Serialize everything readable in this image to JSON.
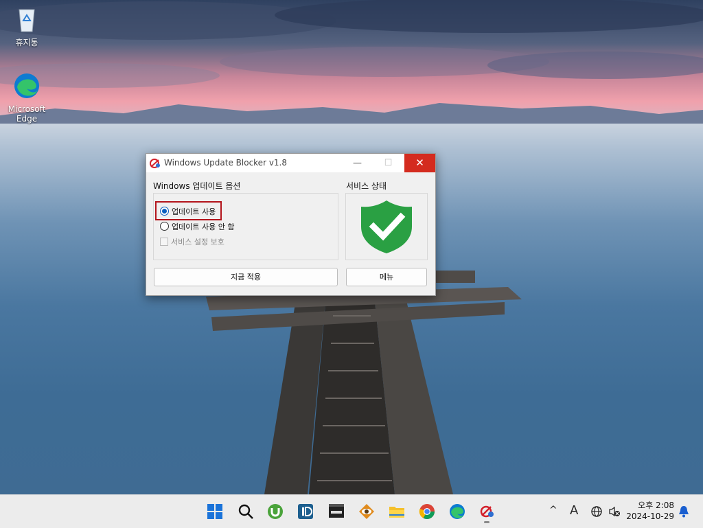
{
  "desktop": {
    "icons": [
      {
        "label": "휴지통"
      },
      {
        "label_line1": "Microsoft",
        "label_line2": "Edge"
      }
    ]
  },
  "window": {
    "title": "Windows Update Blocker v1.8",
    "minimize_glyph": "—",
    "maximize_glyph": "☐",
    "close_glyph": "✕",
    "options_group_label": "Windows 업데이트 옵션",
    "status_group_label": "서비스 상태",
    "options": [
      {
        "label": "업데이트 사용",
        "selected": true
      },
      {
        "label": "업데이트 사용 안 함",
        "selected": false
      }
    ],
    "protect_checkbox": {
      "label": "서비스 설정 보호",
      "checked": false,
      "enabled": false
    },
    "apply_button": "지금 적용",
    "menu_button": "메뉴",
    "status_icon": "green-shield-check-icon",
    "status_color": "#2aa043"
  },
  "taskbar": {
    "icons": [
      "windows-start-icon",
      "search-icon",
      "utorrent-icon",
      "app-1d-icon",
      "mpc-be-icon",
      "eye-app-icon",
      "file-explorer-icon",
      "chrome-icon",
      "edge-icon",
      "windows-update-blocker-icon"
    ],
    "tray": {
      "chevron": "^",
      "ime": "A",
      "time": "오후 2:08",
      "date": "2024-10-29"
    }
  }
}
